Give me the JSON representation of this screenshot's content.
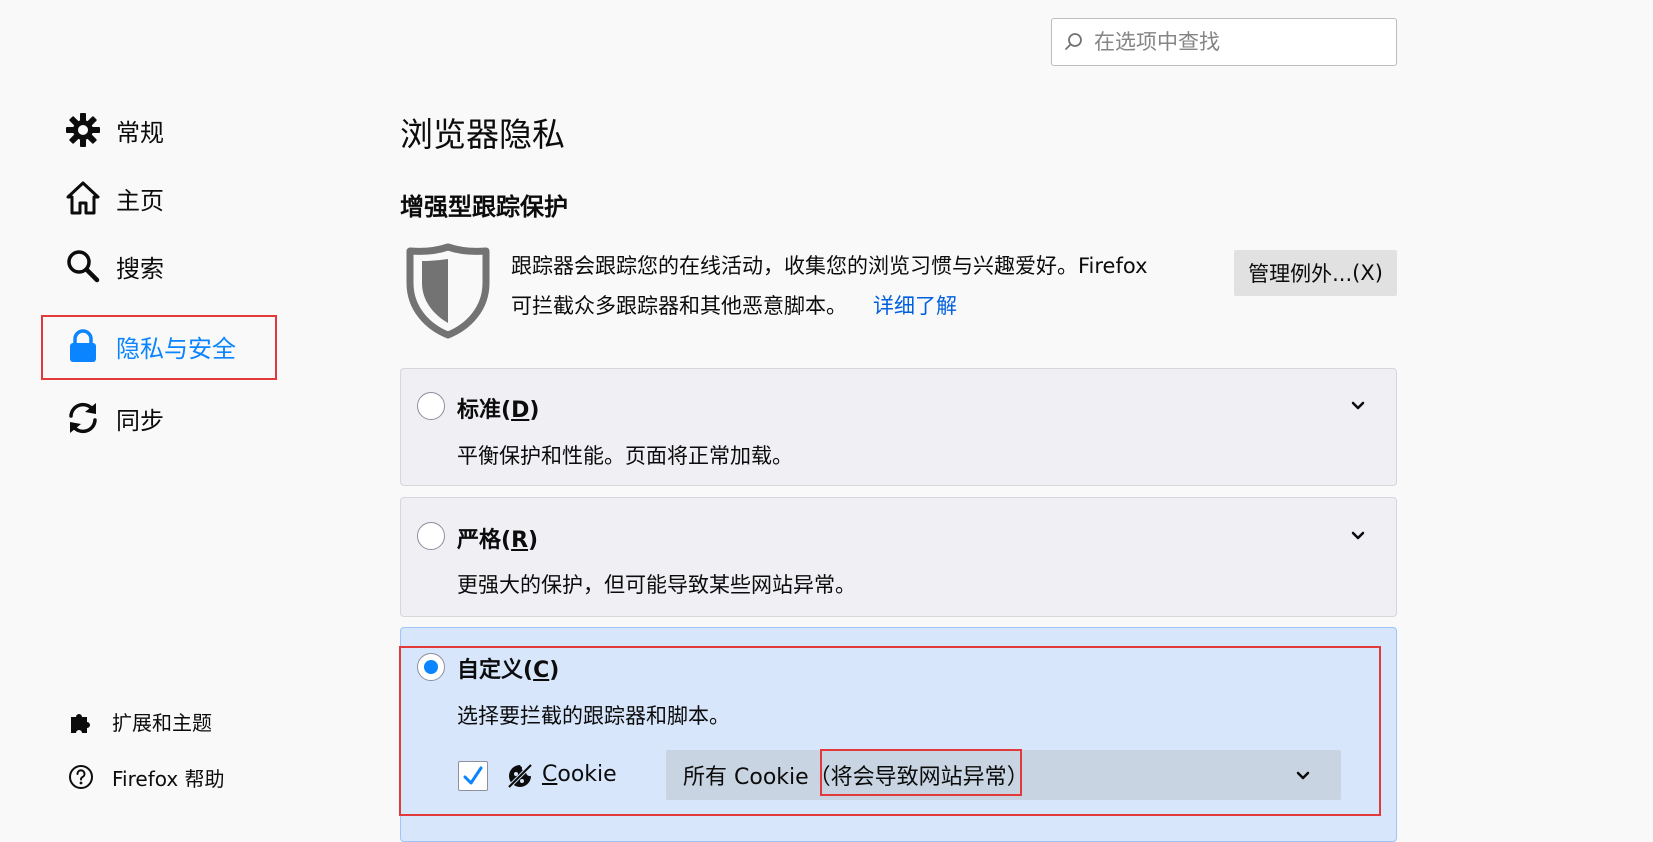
{
  "search": {
    "placeholder": "在选项中查找"
  },
  "sidebar": {
    "items": [
      {
        "label": "常规",
        "icon": "gear-icon"
      },
      {
        "label": "主页",
        "icon": "home-icon"
      },
      {
        "label": "搜索",
        "icon": "search-icon"
      },
      {
        "label": "隐私与安全",
        "icon": "lock-icon",
        "selected": true
      },
      {
        "label": "同步",
        "icon": "sync-icon"
      }
    ],
    "footer": [
      {
        "label": "扩展和主题",
        "icon": "puzzle-icon"
      },
      {
        "label": "Firefox 帮助",
        "icon": "help-icon"
      }
    ]
  },
  "main": {
    "page_title": "浏览器隐私",
    "etp": {
      "title": "增强型跟踪保护",
      "description_line1": "跟踪器会跟踪您的在线活动，收集您的浏览习惯与兴趣爱好。Firefox",
      "description_line2": "可拦截众多跟踪器和其他恶意脚本。",
      "learn_more": "详细了解",
      "exceptions_button": "管理例外...",
      "exceptions_button_accesskey": "(X)"
    },
    "options": [
      {
        "title": "标准",
        "accesskey": "D",
        "description": "平衡保护和性能。页面将正常加载。",
        "checked": false
      },
      {
        "title": "严格",
        "accesskey": "R",
        "description": "更强大的保护，但可能导致某些网站异常。",
        "checked": false
      },
      {
        "title": "自定义",
        "accesskey": "C",
        "description": "选择要拦截的跟踪器和脚本。",
        "checked": true
      }
    ],
    "cookie": {
      "label_first": "C",
      "label_rest": "ookie",
      "checked": true,
      "select_prefix": "所有 Cookie（",
      "select_highlight": "将会导致网站异常",
      "select_suffix": "）"
    }
  },
  "colors": {
    "accent": "#0a84ff",
    "link": "#0060df",
    "highlight_border": "#e23a3a"
  }
}
